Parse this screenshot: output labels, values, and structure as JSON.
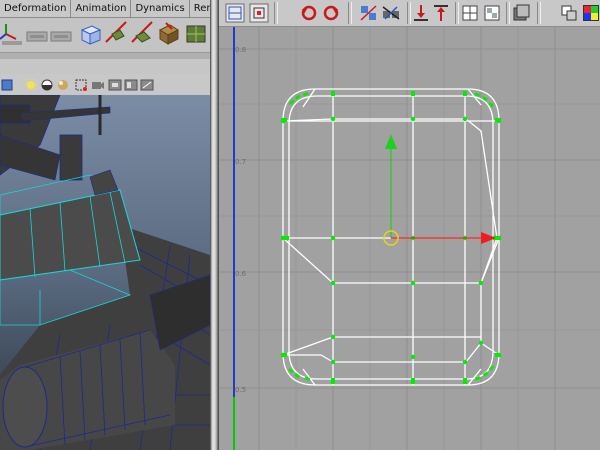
{
  "menu": {
    "tabs": [
      {
        "label": "Deformation"
      },
      {
        "label": "Animation"
      },
      {
        "label": "Dynamics"
      },
      {
        "label": "Rende"
      }
    ]
  },
  "shelf": {
    "icons": [
      "move-icon",
      "rotate-icon",
      "scale-icon",
      "cube-icon",
      "stitch-icon",
      "cut-icon",
      "layout-icon",
      "uv-shell-icon"
    ]
  },
  "panel_toolbar": {
    "icons": [
      "shading-icon",
      "light-icon",
      "texture-icon",
      "material-icon",
      "isolate-icon",
      "camera-icon",
      "resolution-gate-icon",
      "xray-icon"
    ]
  },
  "uv_editor": {
    "toolbar_icons": [
      "uv-mesh-icon",
      "uv-select-icon",
      "rotate-ccw-icon",
      "rotate-cw-icon",
      "cut-uv-icon",
      "sew-uv-icon",
      "flip-u-icon",
      "flip-v-icon",
      "grid-icon",
      "snap-icon",
      "texture-display-icon",
      "dim-image-icon",
      "shaded-uv-icon"
    ],
    "grid_labels": [
      "0.8",
      "0.7",
      "0.6",
      "0.5"
    ],
    "manipulator": {
      "x_axis_color": "#ee1c1c",
      "y_axis_color": "#1ed01e",
      "center_color": "#e8d21a"
    },
    "colors": {
      "background": "#a1a1a1",
      "wireframe": "#ffffff",
      "selected_vertex": "#00ee00",
      "u_axis_line": "#1e3ec8",
      "v_axis_line": "#00cc00"
    }
  }
}
